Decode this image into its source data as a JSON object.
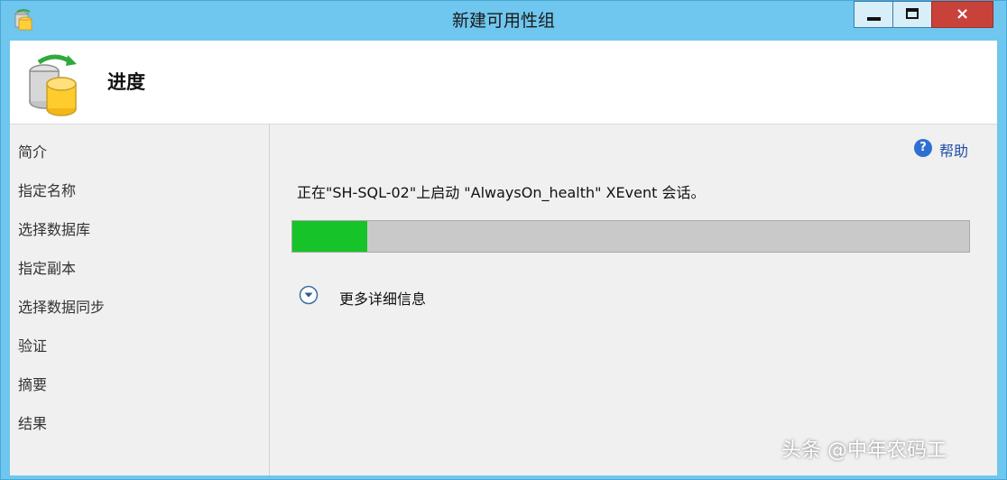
{
  "window": {
    "title": "新建可用性组",
    "controls": {
      "minimize": "minimize",
      "maximize": "maximize",
      "close": "×"
    }
  },
  "header": {
    "title": "进度",
    "icon": "database-sync-icon"
  },
  "sidebar": {
    "items": [
      {
        "label": "简介"
      },
      {
        "label": "指定名称"
      },
      {
        "label": "选择数据库"
      },
      {
        "label": "指定副本"
      },
      {
        "label": "选择数据同步"
      },
      {
        "label": "验证"
      },
      {
        "label": "摘要"
      },
      {
        "label": "结果"
      }
    ]
  },
  "main": {
    "help_label": "帮助",
    "status_text": "正在\"SH-SQL-02\"上启动 \"AlwaysOn_health\" XEvent 会话。",
    "progress_percent": 11,
    "details_label": "更多详细信息"
  },
  "watermark": "头条 @中年农码工",
  "colors": {
    "title_bar": "#6fc6ee",
    "progress_fill": "#16c328",
    "progress_track": "#c9c9c9",
    "close_button": "#c9423a",
    "help_link": "#1f4fa8"
  }
}
